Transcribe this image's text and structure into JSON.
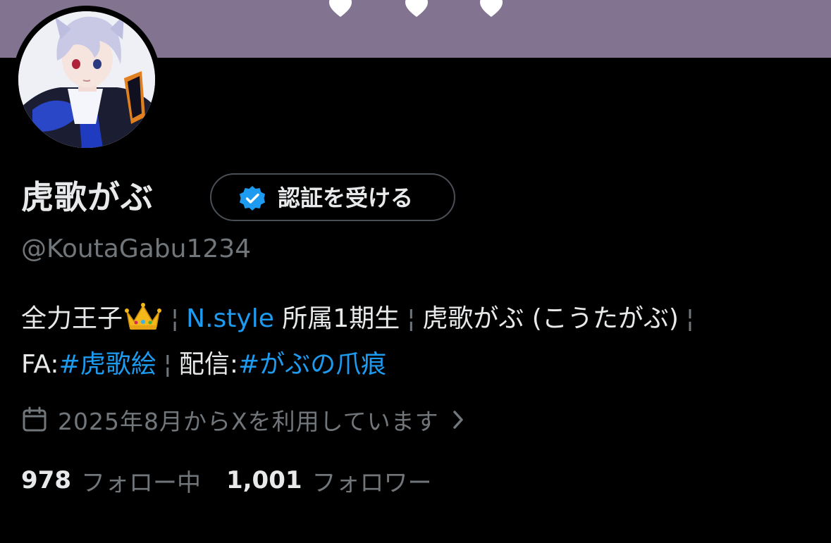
{
  "colors": {
    "banner": "#827490",
    "background": "#000000",
    "text_primary": "#e7e9ea",
    "text_secondary": "#71767b",
    "link": "#1d9bf0",
    "verified_badge": "#1d9bf0"
  },
  "banner": {
    "decorations": [
      "heart-icon",
      "heart-icon",
      "heart-icon"
    ]
  },
  "profile": {
    "avatar_icon": "profile-avatar-illustration",
    "display_name": "虎歌がぶ",
    "verify_button": {
      "icon": "verified-badge-icon",
      "label": "認証を受ける"
    },
    "handle": "@KoutaGabu1234"
  },
  "bio": {
    "line1": {
      "text1": "全力王子",
      "emoji": "crown-emoji",
      "sep": "¦",
      "link_nstyle": "N.style",
      "text2": " 所属1期生",
      "text3": "虎歌がぶ (こうたがぶ)"
    },
    "line2": {
      "fa_label": "FA:",
      "fa_hashtag": "#虎歌絵",
      "stream_label": "配信:",
      "stream_hashtag": "#がぶの爪痕"
    }
  },
  "joined": {
    "icon": "calendar-icon",
    "text": "2025年8月からXを利用しています",
    "chevron": "chevron-right-icon"
  },
  "stats": {
    "following_count": "978",
    "following_label": "フォロー中",
    "followers_count": "1,001",
    "followers_label": "フォロワー"
  }
}
